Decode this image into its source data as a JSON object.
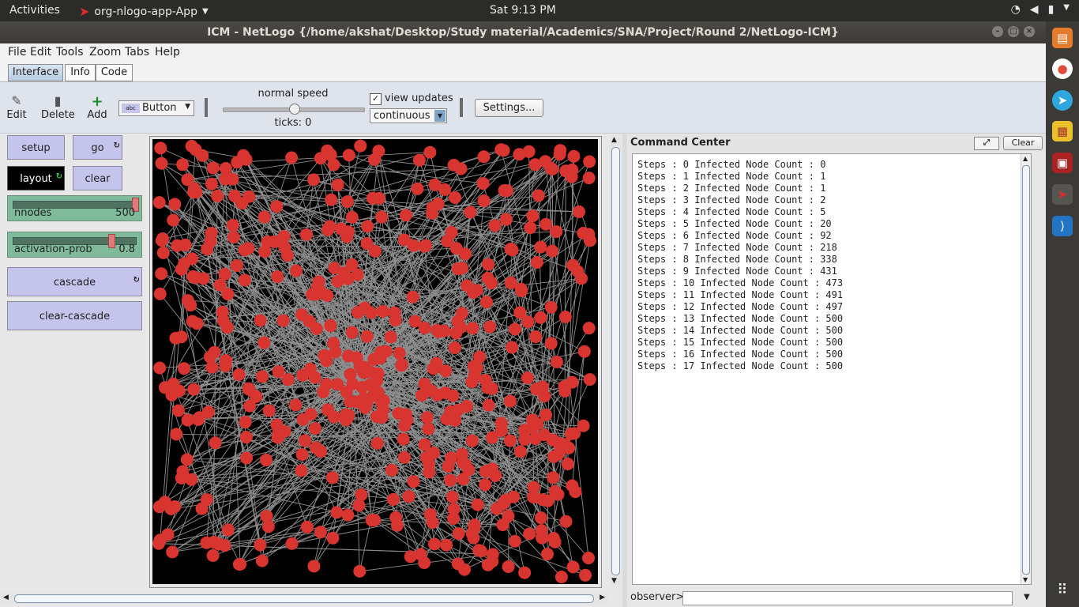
{
  "topbar": {
    "activities": "Activities",
    "app_name": "org-nlogo-app-App",
    "clock": "Sat  9:13 PM"
  },
  "window": {
    "title": "ICM - NetLogo {/home/akshat/Desktop/Study material/Academics/SNA/Project/Round 2/NetLogo-ICM}"
  },
  "menu": [
    "File",
    "Edit",
    "Tools",
    "Zoom",
    "Tabs",
    "Help"
  ],
  "tabs": [
    "Interface",
    "Info",
    "Code"
  ],
  "toolbar": {
    "edit": "Edit",
    "delete": "Delete",
    "add": "Add",
    "widget_type": "Button",
    "speed_label": "normal speed",
    "speed_fraction": 0.5,
    "ticks": "ticks: 0",
    "view_updates": "view updates",
    "update_mode": "continuous",
    "settings": "Settings..."
  },
  "widgets": {
    "setup": "setup",
    "go": "go",
    "layout": "layout",
    "clear": "clear",
    "nnodes": {
      "label": "nnodes",
      "value": "500",
      "fraction": 1.0
    },
    "activation_prob": {
      "label": "activation-prob",
      "value": "0.8",
      "fraction": 0.8
    },
    "cascade": "cascade",
    "clear_cascade": "clear-cascade"
  },
  "command_center": {
    "title": "Command Center",
    "clear": "Clear",
    "observer": "observer>",
    "output": [
      "Steps : 0 Infected Node Count : 0",
      "Steps : 1 Infected Node Count : 1",
      "Steps : 2 Infected Node Count : 1",
      "Steps : 3 Infected Node Count : 2",
      "Steps : 4 Infected Node Count : 5",
      "Steps : 5 Infected Node Count : 20",
      "Steps : 6 Infected Node Count : 92",
      "Steps : 7 Infected Node Count : 218",
      "Steps : 8 Infected Node Count : 338",
      "Steps : 9 Infected Node Count : 431",
      "Steps : 10 Infected Node Count : 473",
      "Steps : 11 Infected Node Count : 491",
      "Steps : 12 Infected Node Count : 497",
      "Steps : 13 Infected Node Count : 500",
      "Steps : 14 Infected Node Count : 500",
      "Steps : 15 Infected Node Count : 500",
      "Steps : 16 Infected Node Count : 500",
      "Steps : 17 Infected Node Count : 500"
    ]
  },
  "colors": {
    "node": "#d93530",
    "link": "#8f8f8f",
    "view_bg": "#000000",
    "button": "#c5c4ec",
    "slider": "#7fbb9a"
  },
  "icons": {
    "edit": "pencil-icon",
    "delete": "trash-icon",
    "add": "plus-icon",
    "forever": "forever-icon"
  }
}
